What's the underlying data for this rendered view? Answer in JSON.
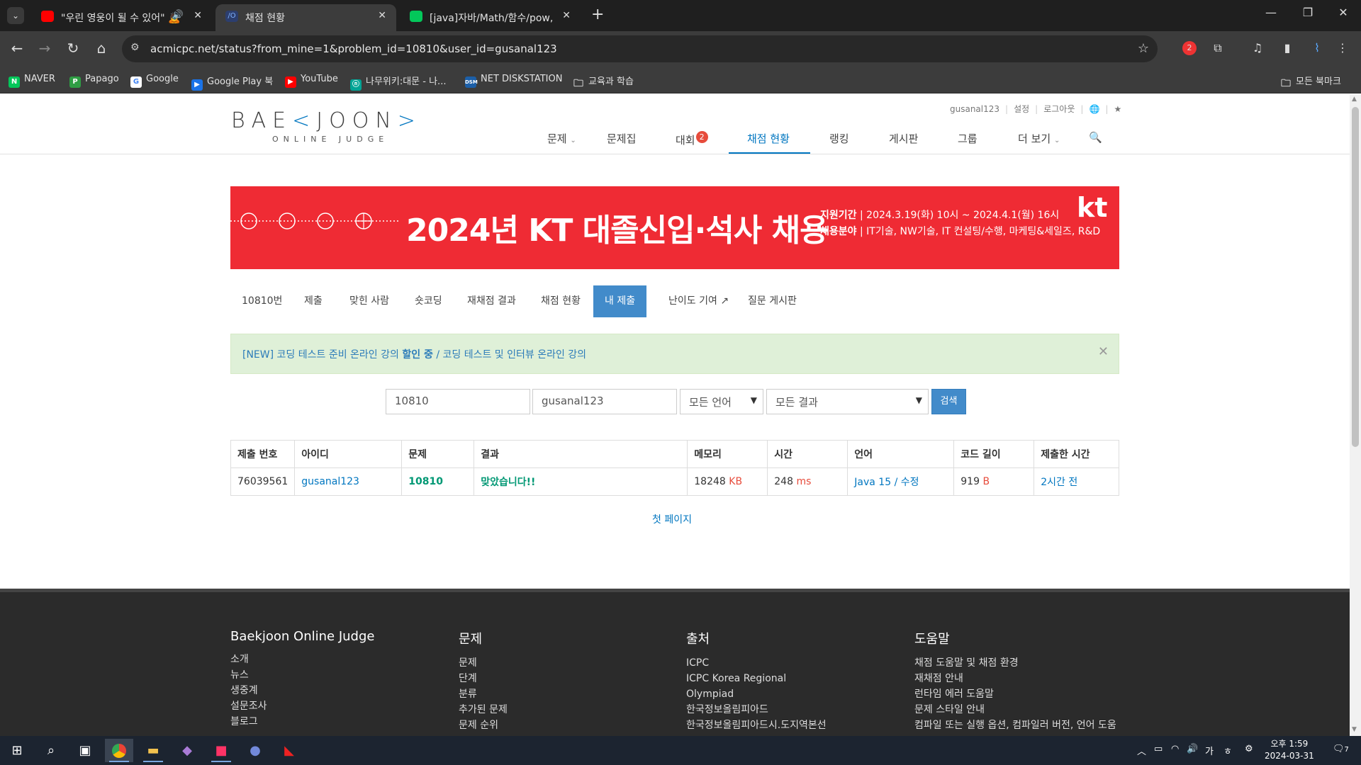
{
  "browser": {
    "tabs": [
      {
        "title": "\"우린 영웅이 될 수 있어\" 🙇",
        "active": false
      },
      {
        "title": "채점 현황",
        "active": true
      },
      {
        "title": "[java]자바/Math/함수/pow, sq",
        "active": false
      }
    ],
    "url": "acmicpc.net/status?from_mine=1&problem_id=10810&user_id=gusanal123",
    "bookmarks": [
      "NAVER",
      "Papago",
      "Google",
      "Google Play 북",
      "YouTube",
      "나무위키:대문 - 나...",
      "NET DISKSTATION",
      "교육과 학습"
    ],
    "all_bookmarks": "모든 북마크",
    "ext_badge": "2"
  },
  "site": {
    "logo_main": "BAE",
    "logo_mid": "JOON",
    "logo_sub": "ONLINE JUDGE",
    "top_menu": [
      "gusanal123",
      "설정",
      "로그아웃"
    ],
    "nav": [
      {
        "label": "문제",
        "dropdown": true
      },
      {
        "label": "문제집"
      },
      {
        "label": "대회",
        "badge": "2"
      },
      {
        "label": "채점 현황",
        "active": true
      },
      {
        "label": "랭킹"
      },
      {
        "label": "게시판"
      },
      {
        "label": "그룹"
      },
      {
        "label": "더 보기",
        "dropdown": true
      }
    ]
  },
  "banner": {
    "headline": "2024년 KT 대졸신입·석사 채용",
    "period_label": "지원기간",
    "period": "2024.3.19(화) 10시 ~ 2024.4.1(월) 16시",
    "field_label": "채용분야",
    "fields": "IT기술, NW기술, IT 컨설팅/수행, 마케팅&세일즈, R&D",
    "brand": "kt",
    "color": "#ef2b34"
  },
  "subtabs": [
    "10810번",
    "제출",
    "맞힌 사람",
    "숏코딩",
    "재채점 결과",
    "채점 현황",
    "내 제출",
    "난이도 기여",
    "질문 게시판"
  ],
  "alert": {
    "prefix": "[NEW] 코딩 테스트 준비 온라인 강의",
    "bold": "할인 중",
    "suffix": "/ 코딩 테스트 및 인터뷰 온라인 강의"
  },
  "search": {
    "problem_id": "10810",
    "user_id": "gusanal123",
    "language": "모든 언어",
    "result": "모든 결과",
    "button": "검색"
  },
  "table": {
    "headers": [
      "제출 번호",
      "아이디",
      "문제",
      "결과",
      "메모리",
      "시간",
      "언어",
      "코드 길이",
      "제출한 시간"
    ],
    "rows": [
      {
        "submission_id": "76039561",
        "user": "gusanal123",
        "problem": "10810",
        "result": "맞았습니다!!",
        "memory": "18248",
        "memory_unit": "KB",
        "time": "248",
        "time_unit": "ms",
        "language": "Java 15",
        "edit": "수정",
        "code_length": "919",
        "code_unit": "B",
        "submitted": "2시간 전"
      }
    ]
  },
  "first_page": "첫 페이지",
  "footer": [
    {
      "title": "Baekjoon Online Judge",
      "links": [
        "소개",
        "뉴스",
        "생중계",
        "설문조사",
        "블로그"
      ]
    },
    {
      "title": "문제",
      "links": [
        "문제",
        "단계",
        "분류",
        "추가된 문제",
        "문제 순위"
      ]
    },
    {
      "title": "출처",
      "links": [
        "ICPC",
        "ICPC Korea Regional",
        "Olympiad",
        "한국정보올림피아드",
        "한국정보올림피아드시.도지역본선"
      ]
    },
    {
      "title": "도움말",
      "links": [
        "채점 도움말 및 채점 환경",
        "재채점 안내",
        "런타임 에러 도움말",
        "문제 스타일 안내",
        "컴파일 또는 실행 옵션, 컴파일러 버전, 언어 도움"
      ]
    }
  ],
  "taskbar": {
    "ime": "가",
    "time": "오후 1:59",
    "date": "2024-03-31",
    "notif": "7"
  }
}
